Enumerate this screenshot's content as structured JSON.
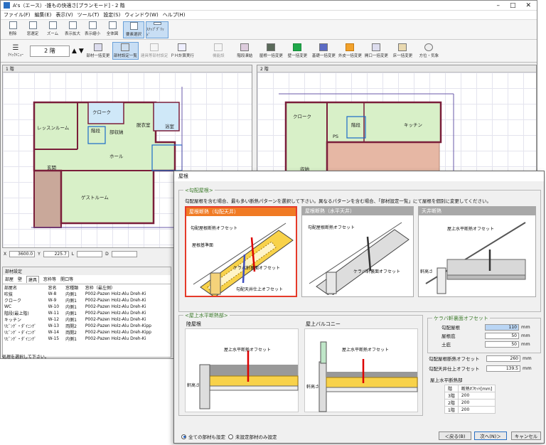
{
  "window": {
    "title": "A's（エース）-誰もの快適さ[プランモード] - 2 階",
    "controls": [
      "–",
      "□",
      "✕"
    ]
  },
  "menu": [
    "ファイル(F)",
    "編集(E)",
    "表示(V)",
    "ツール(T)",
    "設定(S)",
    "ウィンドウ(W)",
    "ヘルプ(H)"
  ],
  "toolbar1": [
    {
      "label": "削除",
      "name": "delete-button"
    },
    {
      "label": "窓選定",
      "name": "window-select-button"
    },
    {
      "label": "ズーム",
      "name": "zoom-button"
    },
    {
      "label": "表示拡大",
      "name": "zoom-in-button"
    },
    {
      "label": "表示縮小",
      "name": "zoom-out-button"
    },
    {
      "label": "全体図",
      "name": "overview-button"
    },
    {
      "label": "要素選択",
      "name": "element-select-button",
      "selected": true
    },
    {
      "label": "ｽﾅｯﾌﾟｸﾞﾘｯﾄﾞ",
      "name": "snap-grid-button",
      "selected": true
    }
  ],
  "toolbar2": {
    "quick_menu": "ｸｲｯｸﾒﾆｭｰ",
    "floor": "2 階",
    "buttons": [
      {
        "label": "部材一括変更",
        "name": "bulk-change-button"
      },
      {
        "label": "部材設定一覧",
        "name": "material-list-button",
        "selected": true
      },
      {
        "label": "建具等部材設定",
        "name": "fittings-button"
      },
      {
        "label": "ＰＨ計算実行",
        "name": "ph-calc-button"
      },
      {
        "label": "機能設",
        "name": "function-button"
      },
      {
        "label": "階段凍結",
        "name": "stairs-button"
      },
      {
        "label": "屋根一括変更",
        "name": "roof-bulk-button"
      },
      {
        "label": "壁一括変更",
        "name": "wall-bulk-button"
      },
      {
        "label": "基礎一括変更",
        "name": "foundation-bulk-button"
      },
      {
        "label": "外皮一括変更",
        "name": "envelope-bulk-button"
      },
      {
        "label": "開口一括変更",
        "name": "opening-bulk-button"
      },
      {
        "label": "床一括変更",
        "name": "floor-bulk-button"
      },
      {
        "label": "方位・気象",
        "name": "orientation-button"
      }
    ]
  },
  "pane1": {
    "title": "1 階",
    "rooms": [
      "レッスンルーム",
      "クローク",
      "階段",
      "部収納",
      "脱衣室",
      "浴室",
      "玄関",
      "ホール",
      "ゲストルーム"
    ]
  },
  "pane2": {
    "title": "2 階",
    "rooms": [
      "クローク",
      "階段",
      "キッチン",
      "PS",
      "収納"
    ]
  },
  "coords": {
    "x_label": "X",
    "x": "3600.0",
    "y_label": "Y",
    "y": "225.7",
    "l_label": "L",
    "d_label": "D"
  },
  "lower": {
    "title": "部材設定",
    "tabs": [
      "部屋",
      "壁",
      "建具",
      "窓枠等",
      "開口等"
    ],
    "active_tab": 2,
    "headers": [
      "部屋名",
      "窓名",
      "窓種類",
      "窓枠（最左側）"
    ],
    "rows": [
      [
        "吹抜",
        "W-8",
        "内側1",
        "P002-Pazen Holz-Alu Dreh-Ki"
      ],
      [
        "クローク",
        "W-9",
        "内側1",
        "P002-Pazen Holz-Alu Dreh-Ki"
      ],
      [
        "WC",
        "W-10",
        "内側1",
        "P002-Pazen Holz-Alu Dreh-Ki"
      ],
      [
        "階段(最上階)",
        "W-11",
        "内側1",
        "P002-Pazen Holz-Alu Dreh-Ki"
      ],
      [
        "キッチン",
        "W-12",
        "内側1",
        "P002-Pazen Holz-Alu Dreh-Ki"
      ],
      [
        "ﾘﾋﾞﾝｸﾞ・ﾀﾞｲﾆﾝｸﾞ",
        "W-13",
        "両開2",
        "P002-Pazen Holz-Alu Dreh-Kipp"
      ],
      [
        "ﾘﾋﾞﾝｸﾞ・ﾀﾞｲﾆﾝｸﾞ",
        "W-14",
        "両開2",
        "P002-Pazen Holz-Alu Dreh-Kipp"
      ],
      [
        "ﾘﾋﾞﾝｸﾞ・ﾀﾞｲﾆﾝｸﾞ",
        "W-15",
        "内側1",
        "P002-Pazen Holz-Alu Dreh-Ki"
      ]
    ]
  },
  "status": "処理を選択して下さい。",
  "dialog": {
    "title": "屋根",
    "group1": {
      "label": "<勾配屋根>",
      "desc": "勾配屋根を含む場合、最も多い断熱パターンを選択して下さい。異なるパターンを含む場合、「部材設定一覧」にて屋根を個別に変更してください。",
      "options": [
        {
          "title": "屋根断熱（勾配天井）",
          "labels": [
            "勾配屋根断熱オフセット",
            "屋根基準面",
            "ケラバ軒裏面オフセット",
            "勾配天井仕上オフセット"
          ]
        },
        {
          "title": "屋根断熱（水平天井）",
          "labels": [
            "勾配屋根断熱オフセット",
            "ケラバ軒裏面オフセット"
          ]
        },
        {
          "title": "天井断熱",
          "labels": [
            "屋上水平断熱オフセット",
            "軒高さ"
          ]
        }
      ]
    },
    "group2": {
      "label": "<屋上水平断熱部>",
      "sub1": "陸屋根",
      "sub2": "屋上バルコニー",
      "labels1": [
        "屋上水平断熱オフセット",
        "軒高さ"
      ],
      "labels2": [
        "屋上水平断熱オフセット",
        "軒高さ"
      ]
    },
    "kerabagroup": "ケラバ軒裏面オフセット",
    "fields": [
      {
        "label": "勾配屋根",
        "value": "110",
        "unit": "mm"
      },
      {
        "label": "屋根庇",
        "value": "50",
        "unit": "mm"
      },
      {
        "label": "土庇",
        "value": "50",
        "unit": "mm"
      }
    ],
    "fields2": [
      {
        "label": "勾配屋根断熱オフセット",
        "value": "260",
        "unit": "mm"
      },
      {
        "label": "勾配天井仕上オフセット",
        "value": "139.5",
        "unit": "mm"
      }
    ],
    "flat_label": "屋上水平断熱部",
    "flat_table": {
      "headers": [
        "階",
        "断熱ｵﾌｾｯﾄ[mm]"
      ],
      "rows": [
        [
          "3階",
          "200"
        ],
        [
          "2階",
          "200"
        ],
        [
          "1階",
          "200"
        ]
      ]
    },
    "radios": [
      {
        "label": "全ての部材も設定",
        "on": true
      },
      {
        "label": "未設定部材のみ設定",
        "on": false
      }
    ],
    "buttons": [
      "＜戻る(B)",
      "次へ(N)＞",
      "キャンセル"
    ]
  }
}
